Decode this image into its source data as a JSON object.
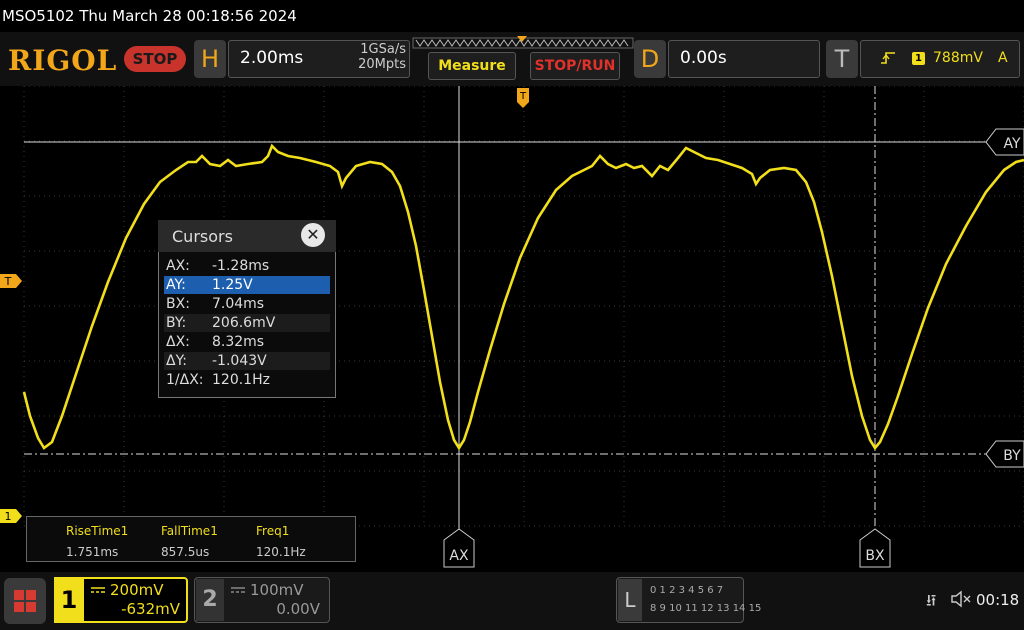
{
  "status_line": "MSO5102  Thu March 28 00:18:56 2024",
  "brand": "RIGOL",
  "run_state": "STOP",
  "horizontal": {
    "label": "H",
    "timebase": "2.00ms",
    "sample_rate": "1GSa/s",
    "memory_depth": "20Mpts"
  },
  "buttons": {
    "measure": "Measure",
    "stop_run": "STOP/RUN"
  },
  "delay": {
    "label": "D",
    "value": "0.00s"
  },
  "trigger": {
    "label": "T",
    "edge_icon": "rising-edge-icon",
    "channel": "1",
    "level": "788mV",
    "mode": "A"
  },
  "cursors": {
    "title": "Cursors",
    "rows": [
      {
        "key": "AX:",
        "value": "-1.28ms"
      },
      {
        "key": "AY:",
        "value": "1.25V"
      },
      {
        "key": "BX:",
        "value": "7.04ms"
      },
      {
        "key": "BY:",
        "value": "206.6mV"
      },
      {
        "key": "ΔX:",
        "value": "8.32ms"
      },
      {
        "key": "ΔY:",
        "value": "-1.043V"
      },
      {
        "key": "1/ΔX:",
        "value": "120.1Hz"
      }
    ],
    "selected_row": 1
  },
  "measurements": [
    {
      "name": "RiseTime1",
      "value": "1.751ms"
    },
    {
      "name": "FallTime1",
      "value": "857.5us"
    },
    {
      "name": "Freq1",
      "value": "120.1Hz"
    }
  ],
  "markers": {
    "ay": "AY",
    "by": "BY",
    "ax": "AX",
    "bx": "BX",
    "trig_level": "T",
    "ch1_ground": "1",
    "trig_pos": "T"
  },
  "channel1": {
    "number": "1",
    "scale": "200mV",
    "offset": "-632mV"
  },
  "channel2": {
    "number": "2",
    "scale": "100mV",
    "offset": "0.00V"
  },
  "logic": {
    "label": "L",
    "row1": "0 1 2 3  4 5 6 7",
    "row2": "8 9 10 11 12 13 14 15"
  },
  "clock": "00:18",
  "colors": {
    "ch1": "#f2df1b",
    "accent": "#f2a71b",
    "stop": "#c8332c",
    "selected": "#1d5fae"
  }
}
